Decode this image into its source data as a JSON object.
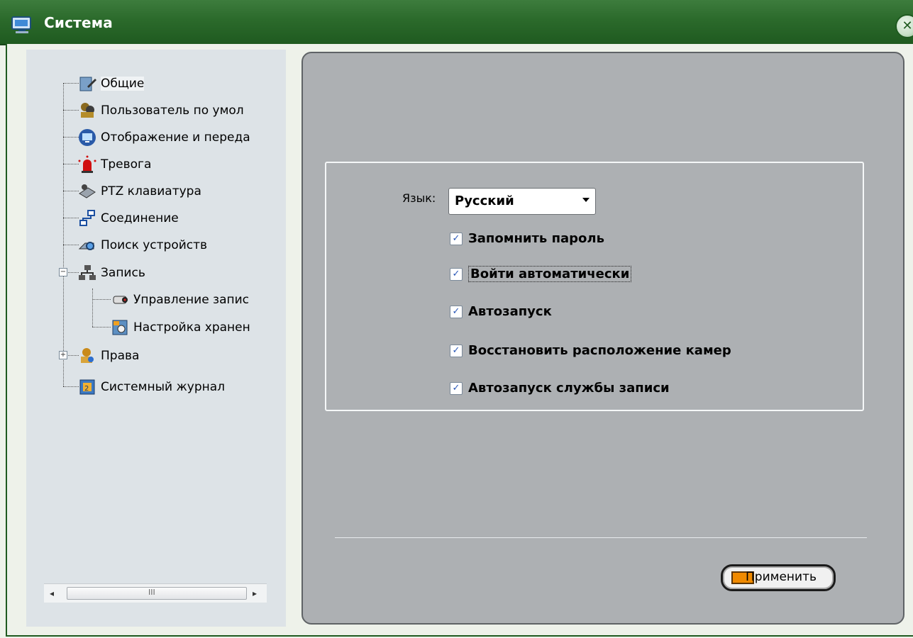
{
  "window": {
    "title": "Система",
    "close_symbol": "✕"
  },
  "tree": {
    "items": [
      {
        "label": "Общие",
        "icon": "edit-document-icon"
      },
      {
        "label": "Пользователь по умол",
        "icon": "users-icon"
      },
      {
        "label": "Отображение и переда",
        "icon": "monitor-icon"
      },
      {
        "label": "Тревога",
        "icon": "alarm-siren-icon"
      },
      {
        "label": "PTZ клавиатура",
        "icon": "ptz-keyboard-icon"
      },
      {
        "label": "Соединение",
        "icon": "network-connection-icon"
      },
      {
        "label": "Поиск устройств",
        "icon": "device-search-icon"
      },
      {
        "label": "Запись",
        "icon": "record-network-icon",
        "expander": "−"
      },
      {
        "label": "Управление запис",
        "icon": "camera-icon"
      },
      {
        "label": "Настройка хранен",
        "icon": "storage-settings-icon"
      },
      {
        "label": "Права",
        "icon": "user-rights-icon",
        "expander": "+"
      },
      {
        "label": "Системный журнал",
        "icon": "system-log-icon"
      }
    ],
    "scrollbar": {
      "left_arrow": "◂",
      "right_arrow": "▸",
      "grip": "III"
    }
  },
  "settings": {
    "language_label": "Язык:",
    "language_value": "Русский",
    "checkboxes": [
      {
        "label": "Запомнить пароль",
        "checked": true
      },
      {
        "label": "Войти автоматически",
        "checked": true
      },
      {
        "label": "Автозапуск",
        "checked": true
      },
      {
        "label": "Восстановить расположение камер",
        "checked": true
      },
      {
        "label": "Автозапуск службы записи",
        "checked": true
      }
    ],
    "check_mark": "✓",
    "apply_label": "Применить"
  },
  "colors": {
    "title_bar": "#2b6a2b",
    "panel": "#adb0b3",
    "tree_bg": "#dde3e7",
    "accent_orange": "#f08a00"
  }
}
